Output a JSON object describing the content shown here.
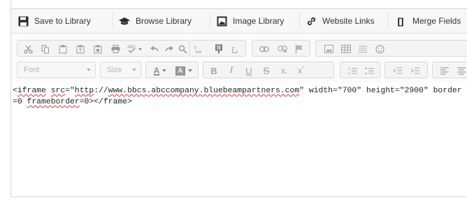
{
  "menubar": {
    "items": [
      {
        "label": "Save to Library",
        "icon": "floppy-disk-icon"
      },
      {
        "label": "Browse Library",
        "icon": "graduation-cap-icon"
      },
      {
        "label": "Image Library",
        "icon": "image-icon"
      },
      {
        "label": "Website Links",
        "icon": "link-icon"
      },
      {
        "label": "Merge Fields",
        "icon": "brackets-icon"
      }
    ],
    "brackets_glyph": "[]"
  },
  "toolbar": {
    "font_combo": "Font",
    "size_combo": "Size",
    "text_color_letter": "A",
    "bg_color_letter": "A",
    "bold": "B",
    "italic": "I",
    "underline": "U",
    "strike": "S",
    "subscript": "x",
    "superscript": "x"
  },
  "editor": {
    "code_parts": [
      {
        "t": "<",
        "sq": false
      },
      {
        "t": "iframe",
        "sq": true
      },
      {
        "t": " ",
        "sq": false
      },
      {
        "t": "src",
        "sq": true
      },
      {
        "t": "=\"",
        "sq": false
      },
      {
        "t": "http",
        "sq": true
      },
      {
        "t": "://",
        "sq": false
      },
      {
        "t": "www.bbcs.abccompany.bluebeampartners.com",
        "sq": true
      },
      {
        "t": "\" width=\"700\" height=\"2900\" border=0 ",
        "sq": false
      },
      {
        "t": "frameborder",
        "sq": true
      },
      {
        "t": "=0></frame>",
        "sq": false
      }
    ]
  },
  "colors": {
    "menubar_bg": "#f7f7f7",
    "toolbar_bg": "#fbfbfb",
    "icon_gray": "#9a9a9a",
    "spell_underline": "#d33"
  }
}
